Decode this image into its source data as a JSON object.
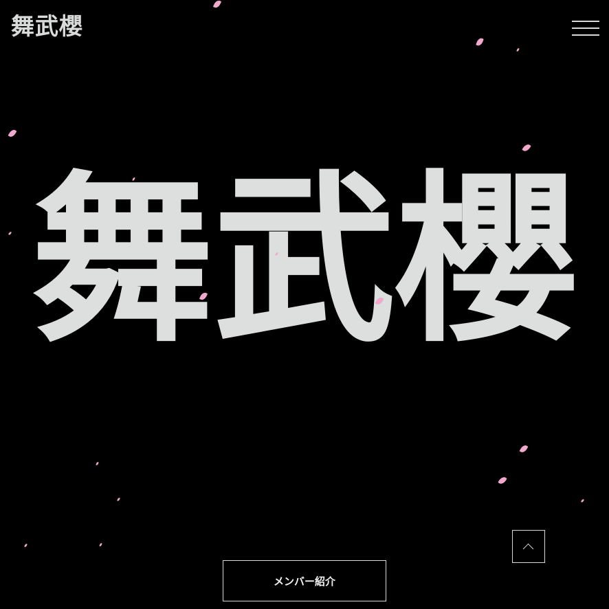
{
  "header": {
    "logo_text": "舞武櫻",
    "menu_icon": "hamburger-menu-icon"
  },
  "hero": {
    "title": "舞武櫻"
  },
  "decorations": {
    "petal_icon": "sakura-petal-icon",
    "petal_color": "#f2a8cc"
  },
  "scroll_top": {
    "icon": "chevron-up-icon"
  },
  "member_button": {
    "label": "メンバー紹介"
  },
  "colors": {
    "background": "#000000",
    "text": "#dcdfde"
  }
}
